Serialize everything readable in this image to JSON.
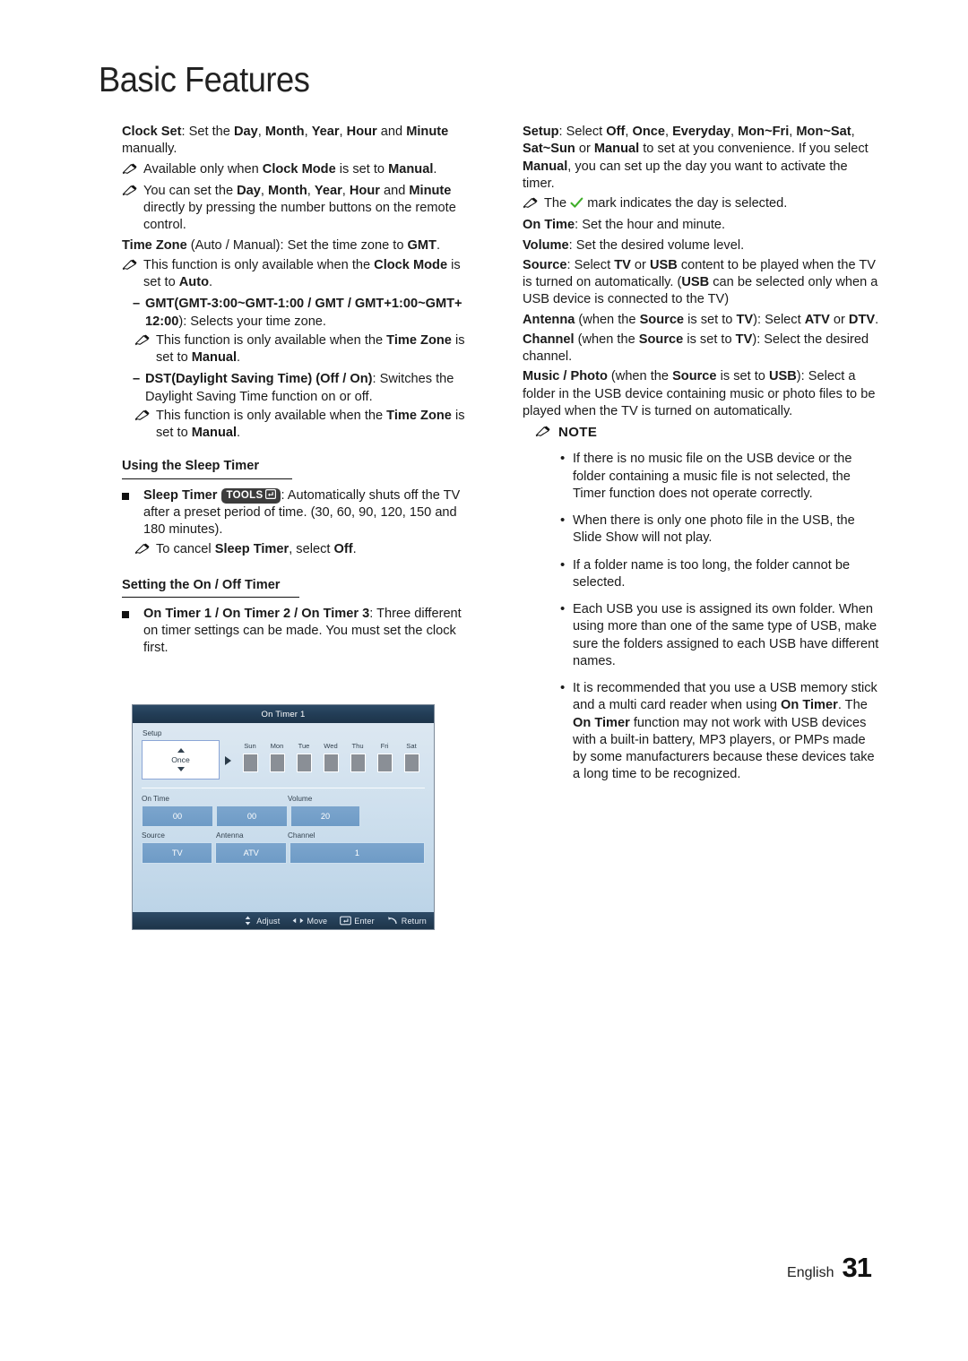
{
  "header": {
    "chapter_title": "Basic Features"
  },
  "left_column": {
    "clock_set": {
      "term": "Clock Set",
      "rest": ": Set the ",
      "b1": "Day",
      "s1": ", ",
      "b2": "Month",
      "s2": ", ",
      "b3": "Year",
      "s3": ", ",
      "b4": "Hour",
      "s4": " and ",
      "b5": "Minute",
      "s5": " manually.",
      "note1_a": "Available only when ",
      "note1_b": "Clock Mode",
      "note1_c": " is set to ",
      "note1_d": "Manual",
      "note1_e": ".",
      "note2_a": "You can set the ",
      "note2_b": "Day",
      "note2_c": ", ",
      "note2_d": "Month",
      "note2_e": ", ",
      "note2_f": "Year",
      "note2_g": ", ",
      "note2_h": "Hour",
      "note2_i": " and ",
      "note2_j": "Minute",
      "note2_k": " directly by pressing the number buttons on the remote control."
    },
    "time_zone": {
      "term": "Time Zone",
      "paren": " (Auto / Manual)",
      "rest": ": Set the time zone to ",
      "gmt": "GMT",
      "period": ".",
      "note_a": "This function is only available when the ",
      "note_b": "Clock Mode",
      "note_c": " is set to ",
      "note_d": "Auto",
      "note_e": "."
    },
    "gmt_item": {
      "bold": "GMT(GMT-3:00~GMT-1:00 / GMT / GMT+1:00~GMT+ 12:00",
      "rest": "): Selects your time zone.",
      "note_a": "This function is only available when the ",
      "note_b": "Time Zone",
      "note_c": " is set to ",
      "note_d": "Manual",
      "note_e": "."
    },
    "dst_item": {
      "bold": "DST(Daylight Saving Time) (Off / On)",
      "rest": ": Switches the Daylight Saving Time function on or off.",
      "note_a": "This function is only available when the ",
      "note_b": "Time Zone",
      "note_c": " is set to ",
      "note_d": "Manual",
      "note_e": "."
    },
    "sleep_heading": "Using the Sleep Timer",
    "sleep_timer": {
      "term": "Sleep Timer",
      "tools_label": "TOOLS",
      "rest": ": Automatically shuts off the TV after a preset period of time. (30, 60, 90, 120, 150 and 180 minutes).",
      "note_a": "To cancel ",
      "note_b": "Sleep Timer",
      "note_c": ", select ",
      "note_d": "Off",
      "note_e": "."
    },
    "onoff_heading": "Setting the On / Off Timer",
    "on_timer": {
      "term": "On Timer 1 / On Timer 2 / On Timer 3",
      "rest": ": Three different on timer settings can be made. You must set the clock first."
    }
  },
  "osd": {
    "title": "On Timer 1",
    "setup_label": "Setup",
    "setup_value": "Once",
    "days": [
      {
        "name": "Sun",
        "checked": false
      },
      {
        "name": "Mon",
        "checked": false
      },
      {
        "name": "Tue",
        "checked": false
      },
      {
        "name": "Wed",
        "checked": false
      },
      {
        "name": "Thu",
        "checked": false
      },
      {
        "name": "Fri",
        "checked": false
      },
      {
        "name": "Sat",
        "checked": false
      }
    ],
    "on_time_label": "On Time",
    "volume_label": "Volume",
    "on_time_hour": "00",
    "on_time_minute": "00",
    "volume_value": "20",
    "source_label": "Source",
    "antenna_label": "Antenna",
    "channel_label": "Channel",
    "source_value": "TV",
    "antenna_value": "ATV",
    "channel_value": "1",
    "hints": [
      {
        "icon": "up-down-arrow-icon",
        "label": "Adjust"
      },
      {
        "icon": "left-right-arrow-icon",
        "label": "Move"
      },
      {
        "icon": "enter-key-icon",
        "label": "Enter"
      },
      {
        "icon": "return-arrow-icon",
        "label": "Return"
      }
    ]
  },
  "right_column": {
    "setup": {
      "term": "Setup",
      "a": ": Select ",
      "b1": "Off",
      "s1": ", ",
      "b2": "Once",
      "s2": ", ",
      "b3": "Everyday",
      "s3": ", ",
      "b4": "Mon~Fri",
      "s4": ", ",
      "b5": "Mon~Sat",
      "s5": ", ",
      "b6": "Sat~Sun",
      "s6": " or ",
      "b7": "Manual",
      "s7": " to set at you convenience. If you select ",
      "b8": "Manual",
      "s8": ", you can set up the day you want to activate the timer.",
      "note_a": "The ",
      "note_b": " mark indicates the day is selected."
    },
    "on_time": {
      "term": "On Time",
      "rest": ": Set the hour and  minute."
    },
    "volume": {
      "term": "Volume",
      "rest": ": Set the desired volume level."
    },
    "source": {
      "term": "Source",
      "a": ": Select ",
      "b1": "TV",
      "s1": " or ",
      "b2": "USB",
      "s2": " content to be played when the TV is turned on automatically. (",
      "b3": "USB",
      "s3": " can be selected only when a USB device is connected to the TV)"
    },
    "antenna": {
      "term": "Antenna",
      "a": " (when the ",
      "b1": "Source",
      "s1": " is set to ",
      "b2": "TV",
      "s2": "): Select ",
      "b3": "ATV",
      "s3": " or ",
      "b4": "DTV",
      "s4": "."
    },
    "channel": {
      "term": "Channel",
      "a": " (when the ",
      "b1": "Source",
      "s1": " is set to ",
      "b2": "TV",
      "s2": "): Select the desired channel."
    },
    "music_photo": {
      "term": "Music / Photo",
      "a": " (when the ",
      "b1": "Source",
      "s1": " is set to ",
      "b2": "USB",
      "s2": "): Select a folder in the USB device containing music or photo files to be played when the TV is turned on automatically."
    },
    "note_heading": "NOTE",
    "notes": [
      {
        "text": "If there is no music file on the USB device or the folder containing a music file is not selected, the Timer function does not operate correctly."
      },
      {
        "text": "When there is only one photo file in the USB, the Slide Show will not play."
      },
      {
        "text": "If a folder name is too long, the folder cannot be selected."
      },
      {
        "text": "Each USB you use is assigned its own folder. When using more than one of the same type of USB, make sure the folders assigned to each USB have different names."
      }
    ],
    "note_last": {
      "a": "It is recommended that you use a USB memory stick and a multi card reader when using ",
      "b1": "On Timer",
      "s1": ". The ",
      "b2": "On Timer",
      "s2": " function may not work with USB devices with a built-in battery, MP3 players, or PMPs made by some manufacturers because these devices take a long time to be recognized."
    }
  },
  "footer": {
    "language": "English",
    "page_number": "31"
  },
  "colors": {
    "text": "#1a1a1a",
    "osd_title_bar": "#223c55",
    "osd_field": "#6e9bc6",
    "check_green": "#3fae29"
  }
}
